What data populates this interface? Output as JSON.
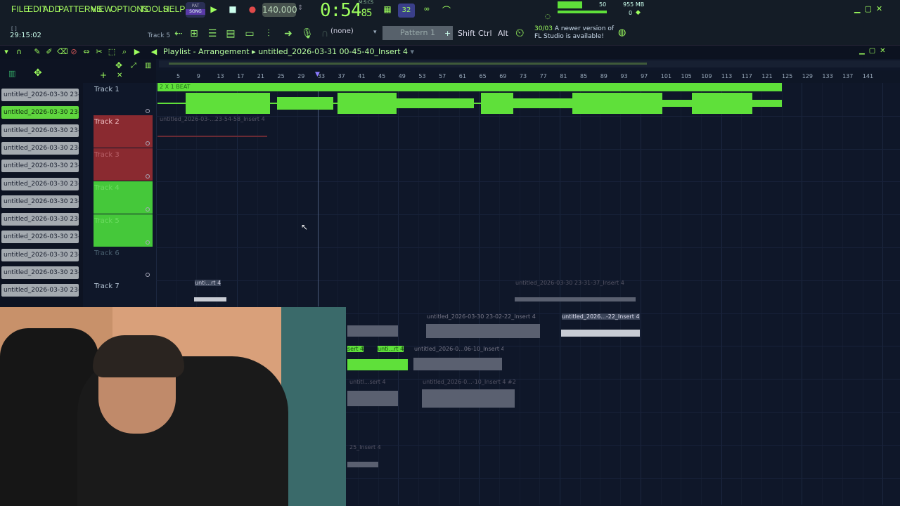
{
  "menu": {
    "items": [
      "FILE",
      "EDIT",
      "ADD",
      "PATTERNS",
      "VIEW",
      "OPTIONS",
      "TOOLS",
      "HELP"
    ]
  },
  "transport": {
    "tempo": "140.000",
    "time_main": "0:54",
    "time_frac": "85",
    "time_label": "M:S:CS"
  },
  "status": {
    "pat_song_top": "PAT",
    "pat_song_bottom": "SONG",
    "cpu_value": "50",
    "memory": "955 MB",
    "poly": "0",
    "step": "32"
  },
  "hint": {
    "time": "29:15:02",
    "track": "Track 5"
  },
  "toolbar": {
    "pattern_select": "(none)",
    "pattern_name": "Pattern 1",
    "shift": "Shift",
    "ctrl": "Ctrl",
    "alt": "Alt"
  },
  "news": {
    "date": "30/03",
    "text": "A newer version of FL Studio is available!"
  },
  "playlist": {
    "title": "Playlist - Arrangement",
    "sep": "▸",
    "file": "untitled_2026-03-31 00-45-40_Insert 4"
  },
  "ruler": [
    "5",
    "9",
    "13",
    "17",
    "21",
    "25",
    "29",
    "33",
    "37",
    "41",
    "45",
    "49",
    "53",
    "57",
    "61",
    "65",
    "69",
    "73",
    "77",
    "81",
    "85",
    "89",
    "93",
    "97",
    "101",
    "105",
    "109",
    "113",
    "117",
    "121",
    "125",
    "129",
    "133",
    "137",
    "141"
  ],
  "clip_list": [
    "untitled_2026-03-30 23-...",
    "untitled_2026-03-30 23-...",
    "untitled_2026-03-30 23-...",
    "untitled_2026-03-30 23-...",
    "untitled_2026-03-30 23-...",
    "untitled_2026-03-30 23-...",
    "untitled_2026-03-30 23-...",
    "untitled_2026-03-30 23-...",
    "untitled_2026-03-30 23-...",
    "untitled_2026-03-30 23-...",
    "untitled_2026-03-30 23-...",
    "untitled_2026-03-30 23-..."
  ],
  "tracks": [
    {
      "name": "Track 1"
    },
    {
      "name": "Track 2"
    },
    {
      "name": "Track 3"
    },
    {
      "name": "Track 4"
    },
    {
      "name": "Track 5"
    },
    {
      "name": "Track 6"
    },
    {
      "name": "Track 7"
    }
  ],
  "clips": {
    "beat": "2 X 1 BEAT",
    "track2": "untitled_2026-03-...23-54-58_Insert 4",
    "track7a": "unti...rt 4",
    "track7b": "untitled_2026-03-30 23-31-37_Insert 4",
    "row8a": "untitled_2026-03-30 23-02-22_Insert 4",
    "row8b": "untitled_2026...-22_Insert 4",
    "row9a": "sert 4",
    "row9b": "unti...rt 4",
    "row9c": "untitled_2026-0...06-10_Insert 4",
    "row10a": "untitl...sert 4",
    "row10b": "untitled_2026-0...-10_Insert 4 #2",
    "row11": "25_Insert 4"
  },
  "colors": {
    "accent": "#9eff5e",
    "bg": "#0f1729",
    "red": "#8a2a30",
    "green": "#45c83a"
  }
}
